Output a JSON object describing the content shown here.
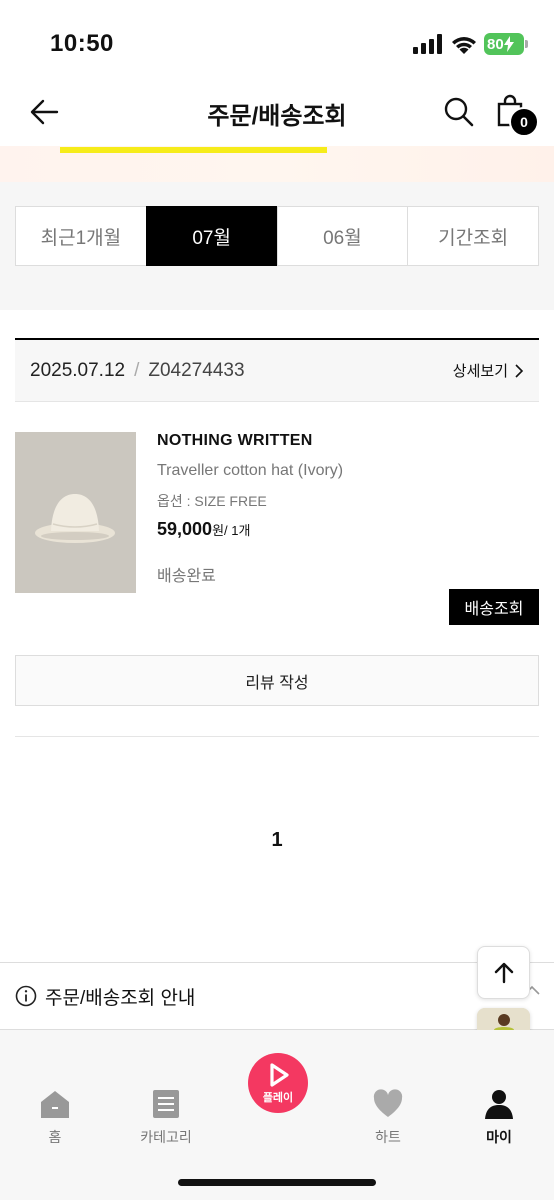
{
  "status_bar": {
    "time": "10:50",
    "battery": "80"
  },
  "header": {
    "title": "주문/배송조회",
    "cart_count": "0"
  },
  "period_tabs": [
    {
      "label": "최근1개월",
      "active": false
    },
    {
      "label": "07월",
      "active": true
    },
    {
      "label": "06월",
      "active": false
    },
    {
      "label": "기간조회",
      "active": false
    }
  ],
  "order": {
    "date": "2025.07.12",
    "separator": "/",
    "order_number": "Z04274433",
    "detail_link": "상세보기",
    "item": {
      "brand": "NOTHING WRITTEN",
      "name": "Traveller cotton hat (Ivory)",
      "option": "옵션 : SIZE FREE",
      "price": "59,000",
      "price_unit": "원",
      "quantity": "/ 1개",
      "status": "배송완료"
    },
    "track_button": "배송조회",
    "review_button": "리뷰 작성"
  },
  "pagination": {
    "current": "1"
  },
  "info_bar": {
    "label": "주문/배송조회 안내"
  },
  "bottom_nav": [
    {
      "label": "홈",
      "icon": "home-icon"
    },
    {
      "label": "카테고리",
      "icon": "category-icon"
    },
    {
      "label": "플레이",
      "icon": "play-icon"
    },
    {
      "label": "하트",
      "icon": "heart-icon"
    },
    {
      "label": "마이",
      "icon": "person-icon"
    }
  ],
  "colors": {
    "accent": "#f43861",
    "highlight": "#f6ec1a",
    "battery": "#52c45a"
  }
}
